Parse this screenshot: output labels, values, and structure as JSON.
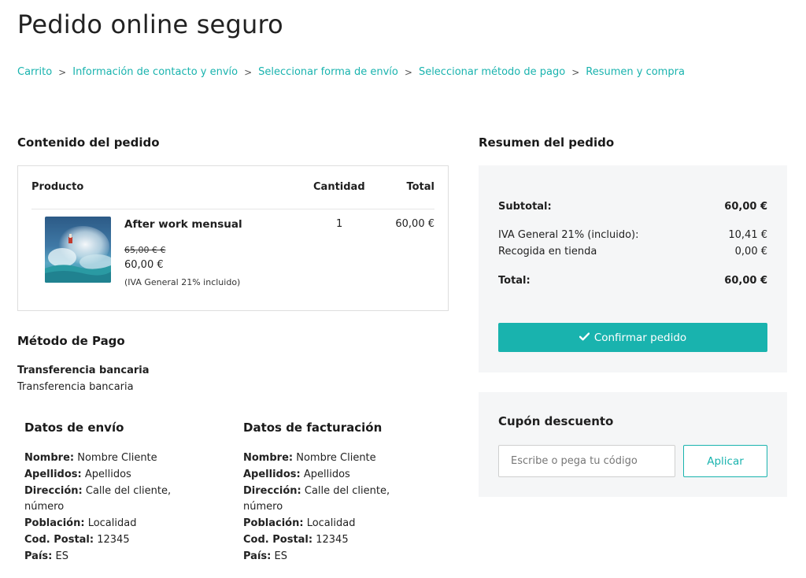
{
  "page": {
    "title": "Pedido online seguro"
  },
  "breadcrumb": [
    "Carrito",
    "Información de contacto y envío",
    "Seleccionar forma de envío",
    "Seleccionar método de pago",
    "Resumen y compra"
  ],
  "breadcrumb_separator": ">",
  "order": {
    "heading": "Contenido del pedido",
    "columns": {
      "product": "Producto",
      "quantity": "Cantidad",
      "total": "Total"
    },
    "items": [
      {
        "name": "After work mensual",
        "old_price": "65,00 € €",
        "price": "60,00 €",
        "tax_note": "(IVA General 21% incluido)",
        "quantity": "1",
        "total": "60,00 €"
      }
    ]
  },
  "payment": {
    "heading": "Método de Pago",
    "name": "Transferencia bancaria",
    "description": "Transferencia bancaria"
  },
  "shipping": {
    "heading": "Datos de envío",
    "labels": {
      "name": "Nombre:",
      "surname": "Apellidos:",
      "address": "Dirección:",
      "city": "Población:",
      "zip": "Cod. Postal:",
      "country": "País:"
    },
    "name": "Nombre Cliente",
    "surname": "Apellidos",
    "address_1": "Calle del cliente,",
    "address_2": "número",
    "city": "Localidad",
    "zip": "12345",
    "country": "ES"
  },
  "billing": {
    "heading": "Datos de facturación",
    "labels": {
      "name": "Nombre:",
      "surname": "Apellidos:",
      "address": "Dirección:",
      "city": "Población:",
      "zip": "Cod. Postal:",
      "country": "País:"
    },
    "name": "Nombre Cliente",
    "surname": "Apellidos",
    "address_1": "Calle del cliente,",
    "address_2": "número",
    "city": "Localidad",
    "zip": "12345",
    "country": "ES"
  },
  "summary": {
    "heading": "Resumen del pedido",
    "subtotal_label": "Subtotal:",
    "subtotal": "60,00 €",
    "tax_label": "IVA General 21% (incluido):",
    "tax": "10,41 €",
    "pickup_label": "Recogida en tienda",
    "pickup": "0,00 €",
    "total_label": "Total:",
    "total": "60,00 €",
    "confirm_label": "Confirmar pedido",
    "confirm_icon": "check-icon"
  },
  "coupon": {
    "heading": "Cupón descuento",
    "placeholder": "Escribe o pega tu código",
    "value": "",
    "apply_label": "Aplicar"
  },
  "colors": {
    "accent": "#19b3ae",
    "panel": "#f5f6f7"
  }
}
